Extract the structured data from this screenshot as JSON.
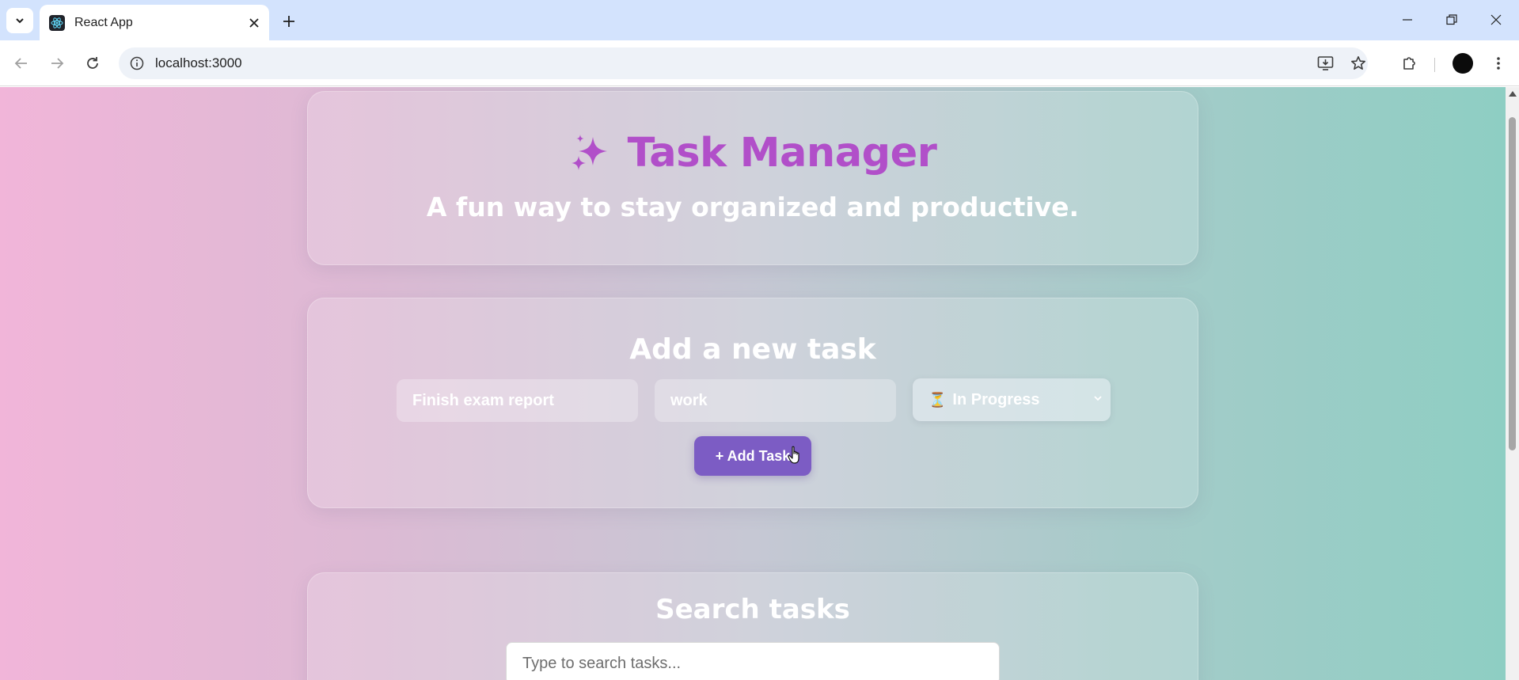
{
  "browser": {
    "tab_title": "React App",
    "url": "localhost:3000",
    "icons": {
      "tab_search": "chevron-down-icon",
      "favicon": "react-logo-icon",
      "tab_close": "close-icon",
      "new_tab": "plus-icon",
      "back": "arrow-left-icon",
      "forward": "arrow-right-icon",
      "reload": "reload-icon",
      "site_info": "site-info-icon",
      "install": "install-app-icon",
      "bookmark": "star-icon",
      "extensions": "puzzle-icon",
      "menu": "kebab-menu-icon"
    }
  },
  "hero": {
    "icon": "sparkles-icon",
    "title": "Task Manager",
    "subtitle": "A fun way to stay organized and productive."
  },
  "form": {
    "heading": "Add a new task",
    "task_title_value": "Finish exam report",
    "category_value": "work",
    "status_icon": "⏳",
    "status_value": "In Progress",
    "add_button_label": "+ Add Task"
  },
  "search": {
    "heading": "Search tasks",
    "placeholder": "Type to search tasks..."
  },
  "colors": {
    "title": "#b14fc9",
    "button": "#7c5cc4",
    "gradient_left": "#f1b5d9",
    "gradient_right": "#8ecec3"
  }
}
